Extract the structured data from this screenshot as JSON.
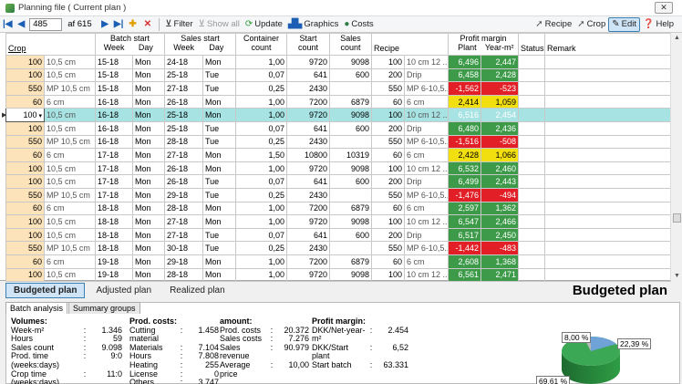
{
  "window": {
    "title": "Planning file   ( Current plan )",
    "close": "✕"
  },
  "toolbar": {
    "record": "485",
    "of_label": "af 615",
    "filter": "Filter",
    "show_all": "Show all",
    "update": "Update",
    "graphics": "Graphics",
    "costs": "Costs",
    "recipe": "Recipe",
    "crop": "Crop",
    "edit": "Edit",
    "help": "Help"
  },
  "grid": {
    "headers": {
      "crop": "Crop",
      "batch_start": "Batch start",
      "sales_start": "Sales start",
      "week": "Week",
      "day": "Day",
      "container_count": "Container count",
      "start_count": "Start count",
      "sales_count": "Sales count",
      "recipe": "Recipe",
      "profit_margin": "Profit margin",
      "plant": "Plant",
      "year_m2": "Year-m²",
      "status": "Status",
      "remark": "Remark"
    },
    "rows": [
      {
        "crop": "100",
        "crop_desc": "10,5 cm",
        "bw": "15-18",
        "bd": "Mon",
        "sw": "24-18",
        "sd": "Mon",
        "cont": "1,00",
        "start": "9720",
        "sales": "9098",
        "rec": "100",
        "rec_desc": "10 cm 12 ...",
        "plant": "6,496",
        "year": "2,447",
        "pc": "pos",
        "yc": "pos"
      },
      {
        "crop": "100",
        "crop_desc": "10,5 cm",
        "bw": "15-18",
        "bd": "Mon",
        "sw": "25-18",
        "sd": "Tue",
        "cont": "0,07",
        "start": "641",
        "sales": "600",
        "rec": "200",
        "rec_desc": "Drip",
        "plant": "6,458",
        "year": "2,428",
        "pc": "pos",
        "yc": "pos"
      },
      {
        "crop": "550",
        "crop_desc": "MP 10,5 cm",
        "bw": "15-18",
        "bd": "Mon",
        "sw": "27-18",
        "sd": "Tue",
        "cont": "0,25",
        "start": "2430",
        "sales": "",
        "rec": "550",
        "rec_desc": "MP 6-10,5...",
        "plant": "-1,562",
        "year": "-523",
        "pc": "neg",
        "yc": "neg"
      },
      {
        "crop": "60",
        "crop_desc": "6 cm",
        "bw": "16-18",
        "bd": "Mon",
        "sw": "26-18",
        "sd": "Mon",
        "cont": "1,00",
        "start": "7200",
        "sales": "6879",
        "rec": "60",
        "rec_desc": "6 cm",
        "plant": "2,414",
        "year": "1,059",
        "pc": "yel",
        "yc": "yel"
      },
      {
        "crop": "100",
        "crop_desc": "10,5 cm",
        "bw": "16-18",
        "bd": "Mon",
        "sw": "25-18",
        "sd": "Mon",
        "cont": "1,00",
        "start": "9720",
        "sales": "9098",
        "rec": "100",
        "rec_desc": "10 cm 12 ...",
        "plant": "6,516",
        "year": "2,454",
        "pc": "pos",
        "yc": "pos",
        "selected": true
      },
      {
        "crop": "100",
        "crop_desc": "10,5 cm",
        "bw": "16-18",
        "bd": "Mon",
        "sw": "25-18",
        "sd": "Tue",
        "cont": "0,07",
        "start": "641",
        "sales": "600",
        "rec": "200",
        "rec_desc": "Drip",
        "plant": "6,480",
        "year": "2,436",
        "pc": "pos",
        "yc": "pos"
      },
      {
        "crop": "550",
        "crop_desc": "MP 10,5 cm",
        "bw": "16-18",
        "bd": "Mon",
        "sw": "28-18",
        "sd": "Tue",
        "cont": "0,25",
        "start": "2430",
        "sales": "",
        "rec": "550",
        "rec_desc": "MP 6-10,5...",
        "plant": "-1,516",
        "year": "-508",
        "pc": "neg",
        "yc": "neg"
      },
      {
        "crop": "60",
        "crop_desc": "6 cm",
        "bw": "17-18",
        "bd": "Mon",
        "sw": "27-18",
        "sd": "Mon",
        "cont": "1,50",
        "start": "10800",
        "sales": "10319",
        "rec": "60",
        "rec_desc": "6 cm",
        "plant": "2,428",
        "year": "1,066",
        "pc": "yel",
        "yc": "yel"
      },
      {
        "crop": "100",
        "crop_desc": "10,5 cm",
        "bw": "17-18",
        "bd": "Mon",
        "sw": "26-18",
        "sd": "Mon",
        "cont": "1,00",
        "start": "9720",
        "sales": "9098",
        "rec": "100",
        "rec_desc": "10 cm 12 ...",
        "plant": "6,532",
        "year": "2,460",
        "pc": "pos",
        "yc": "pos"
      },
      {
        "crop": "100",
        "crop_desc": "10,5 cm",
        "bw": "17-18",
        "bd": "Mon",
        "sw": "26-18",
        "sd": "Tue",
        "cont": "0,07",
        "start": "641",
        "sales": "600",
        "rec": "200",
        "rec_desc": "Drip",
        "plant": "6,499",
        "year": "2,443",
        "pc": "pos",
        "yc": "pos"
      },
      {
        "crop": "550",
        "crop_desc": "MP 10,5 cm",
        "bw": "17-18",
        "bd": "Mon",
        "sw": "29-18",
        "sd": "Tue",
        "cont": "0,25",
        "start": "2430",
        "sales": "",
        "rec": "550",
        "rec_desc": "MP 6-10,5...",
        "plant": "-1,476",
        "year": "-494",
        "pc": "neg",
        "yc": "neg"
      },
      {
        "crop": "60",
        "crop_desc": "6 cm",
        "bw": "18-18",
        "bd": "Mon",
        "sw": "28-18",
        "sd": "Mon",
        "cont": "1,00",
        "start": "7200",
        "sales": "6879",
        "rec": "60",
        "rec_desc": "6 cm",
        "plant": "2,597",
        "year": "1,362",
        "pc": "pos",
        "yc": "pos"
      },
      {
        "crop": "100",
        "crop_desc": "10,5 cm",
        "bw": "18-18",
        "bd": "Mon",
        "sw": "27-18",
        "sd": "Mon",
        "cont": "1,00",
        "start": "9720",
        "sales": "9098",
        "rec": "100",
        "rec_desc": "10 cm 12 ...",
        "plant": "6,547",
        "year": "2,466",
        "pc": "pos",
        "yc": "pos"
      },
      {
        "crop": "100",
        "crop_desc": "10,5 cm",
        "bw": "18-18",
        "bd": "Mon",
        "sw": "27-18",
        "sd": "Tue",
        "cont": "0,07",
        "start": "641",
        "sales": "600",
        "rec": "200",
        "rec_desc": "Drip",
        "plant": "6,517",
        "year": "2,450",
        "pc": "pos",
        "yc": "pos"
      },
      {
        "crop": "550",
        "crop_desc": "MP 10,5 cm",
        "bw": "18-18",
        "bd": "Mon",
        "sw": "30-18",
        "sd": "Tue",
        "cont": "0,25",
        "start": "2430",
        "sales": "",
        "rec": "550",
        "rec_desc": "MP 6-10,5...",
        "plant": "-1,442",
        "year": "-483",
        "pc": "neg",
        "yc": "neg"
      },
      {
        "crop": "60",
        "crop_desc": "6 cm",
        "bw": "19-18",
        "bd": "Mon",
        "sw": "29-18",
        "sd": "Mon",
        "cont": "1,00",
        "start": "7200",
        "sales": "6879",
        "rec": "60",
        "rec_desc": "6 cm",
        "plant": "2,608",
        "year": "1,368",
        "pc": "pos",
        "yc": "pos"
      },
      {
        "crop": "100",
        "crop_desc": "10,5 cm",
        "bw": "19-18",
        "bd": "Mon",
        "sw": "28-18",
        "sd": "Mon",
        "cont": "1,00",
        "start": "9720",
        "sales": "9098",
        "rec": "100",
        "rec_desc": "10 cm 12 ...",
        "plant": "6,561",
        "year": "2,471",
        "pc": "pos",
        "yc": "pos"
      }
    ]
  },
  "plan_tabs": [
    "Budgeted plan",
    "Adjusted plan",
    "Realized plan"
  ],
  "plan_title": "Budgeted plan",
  "bottom_tabs": [
    "Batch analysis",
    "Summary groups"
  ],
  "analysis": {
    "volumes": {
      "title": "Volumes:",
      "items": [
        [
          "Week-m²",
          "1.346"
        ],
        [
          "Hours",
          "59"
        ],
        [
          "Sales count",
          "9.098"
        ],
        [
          "Prod. time (weeks:days)",
          "9:0"
        ],
        [
          "Crop time (weeks:days)",
          "11:0"
        ]
      ]
    },
    "prod_costs": {
      "title": "Prod. costs:",
      "items": [
        [
          "Cutting material",
          "1.458"
        ],
        [
          "Materials",
          "7.104"
        ],
        [
          "Hours",
          "7.808"
        ],
        [
          "Heating",
          "255"
        ],
        [
          "License",
          "0"
        ],
        [
          "Others",
          "3.747"
        ]
      ]
    },
    "amount": {
      "title": "amount:",
      "items": [
        [
          "Prod. costs",
          "20.372"
        ],
        [
          "Sales costs",
          "7.276"
        ],
        [
          "Sales revenue",
          "90.979"
        ],
        [
          "Average price",
          "10,00"
        ]
      ]
    },
    "profit_margin": {
      "title": "Profit margin:",
      "items": [
        [
          "DKK/Net-year-m²",
          "2.454"
        ],
        [
          "DKK/Start plant",
          "6,52"
        ],
        [
          "Start batch",
          "63.331"
        ]
      ]
    }
  },
  "pie_labels": [
    "8,00 %",
    "22,39 %",
    "69,61 %"
  ],
  "colors": {
    "positive": "#3c9a48",
    "negative": "#e21f26",
    "warning": "#f2df0f",
    "selected_row": "#a7e3e3",
    "crop_column": "#fde3b9"
  }
}
